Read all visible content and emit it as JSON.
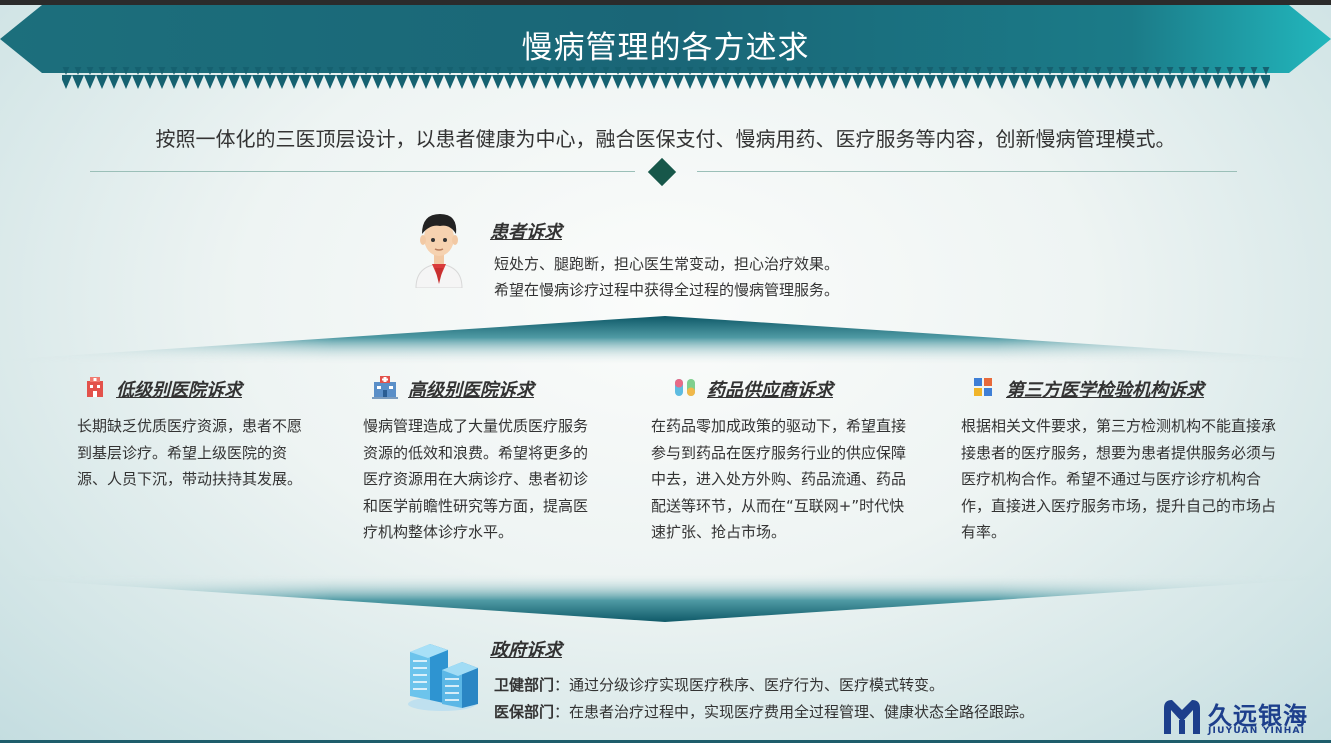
{
  "title": "慢病管理的各方述求",
  "intro": "按照一体化的三医顶层设计，以患者健康为中心，融合医保支付、慢病用药、医疗服务等内容，创新慢病管理模式。",
  "patient": {
    "heading": "患者诉求",
    "lines": [
      "短处方、腿跑断，担心医生常变动，担心治疗效果。",
      "希望在慢病诊疗过程中获得全过程的慢病管理服务。"
    ]
  },
  "columns": [
    {
      "heading": "低级别医院诉求",
      "icon": "hospital-icon",
      "text": "长期缺乏优质医疗资源，患者不愿到基层诊疗。希望上级医院的资源、人员下沉，带动扶持其发展。"
    },
    {
      "heading": "高级别医院诉求",
      "icon": "large-hospital-icon",
      "text": "慢病管理造成了大量优质医疗服务资源的低效和浪费。希望将更多的医疗资源用在大病诊疗、患者初诊和医学前瞻性研究等方面，提高医疗机构整体诊疗水平。"
    },
    {
      "heading": "药品供应商诉求",
      "icon": "capsule-icon",
      "text": "在药品零加成政策的驱动下，希望直接参与到药品在医疗服务行业的供应保障中去，进入处方外购、药品流通、药品配送等环节，从而在“互联网+”时代快速扩张、抢占市场。"
    },
    {
      "heading": "第三方医学检验机构诉求",
      "icon": "lab-blocks-icon",
      "text": "根据相关文件要求，第三方检测机构不能直接承接患者的医疗服务，想要为患者提供服务必须与医疗机构合作。希望不通过与医疗诊疗机构合作，直接进入医疗服务市场，提升自己的市场占有率。"
    }
  ],
  "government": {
    "heading": "政府诉求",
    "lines": [
      {
        "label": "卫健部门",
        "text": "：通过分级诊疗实现医疗秩序、医疗行为、医疗模式转变。"
      },
      {
        "label": "医保部门",
        "text": "：在患者治疗过程中，实现医疗费用全过程管理、健康状态全路径跟踪。"
      }
    ]
  },
  "logo": {
    "cn": "久远银海",
    "en": "JIUYUAN YINHAI"
  },
  "colors": {
    "teal_dark": "#125b6a",
    "teal": "#1a7d8a",
    "teal_light": "#1fb0b8",
    "accent_diamond": "#17574a"
  }
}
